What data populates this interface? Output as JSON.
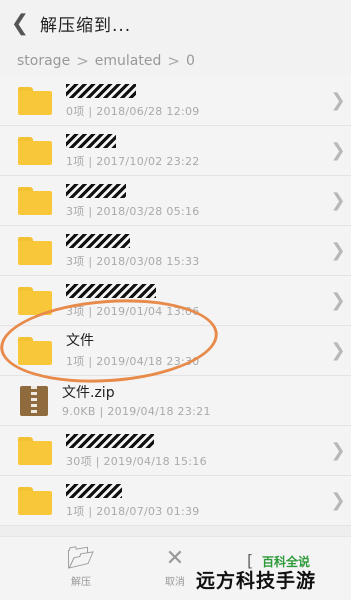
{
  "header": {
    "back_icon": "chevron-left-icon",
    "title": "解压缩到..."
  },
  "breadcrumb": {
    "parts": [
      "storage",
      "emulated",
      "0"
    ],
    "separator": ">"
  },
  "files": [
    {
      "type": "folder",
      "name": "",
      "meta": "0项 | 2018/06/28 12:09",
      "redacted": true
    },
    {
      "type": "folder",
      "name": "",
      "meta": "1项 | 2017/10/02 23:22",
      "redacted": true
    },
    {
      "type": "folder",
      "name": "",
      "meta": "3项 | 2018/03/28 05:16",
      "redacted": true
    },
    {
      "type": "folder",
      "name": "",
      "meta": "3项 | 2018/03/08 15:33",
      "redacted": true
    },
    {
      "type": "folder",
      "name": "",
      "meta": "3项 | 2019/01/04 13:06",
      "redacted": true
    },
    {
      "type": "folder",
      "name": "文件",
      "meta": "1项 | 2019/04/18 23:30",
      "redacted": false,
      "highlighted": true
    },
    {
      "type": "zip",
      "name": "文件.zip",
      "meta": "9.0KB | 2019/04/18 23:21",
      "redacted": false
    },
    {
      "type": "folder",
      "name": "",
      "meta": "30项 | 2019/04/18 15:16",
      "redacted": true
    },
    {
      "type": "folder",
      "name": "",
      "meta": "1项 | 2018/07/03 01:39",
      "redacted": true
    }
  ],
  "toolbar": {
    "extract_label": "解压",
    "extract_icon": "folder-open-icon",
    "cancel_label": "取消",
    "cancel_icon": "close-icon"
  },
  "watermark": {
    "brand": "百科全说",
    "site": "远方科技手游"
  },
  "colors": {
    "folder": "#f9c83a",
    "zip": "#8f6a3c",
    "highlight_circle": "#e88a4a",
    "brand_green": "#2e9b3a"
  }
}
